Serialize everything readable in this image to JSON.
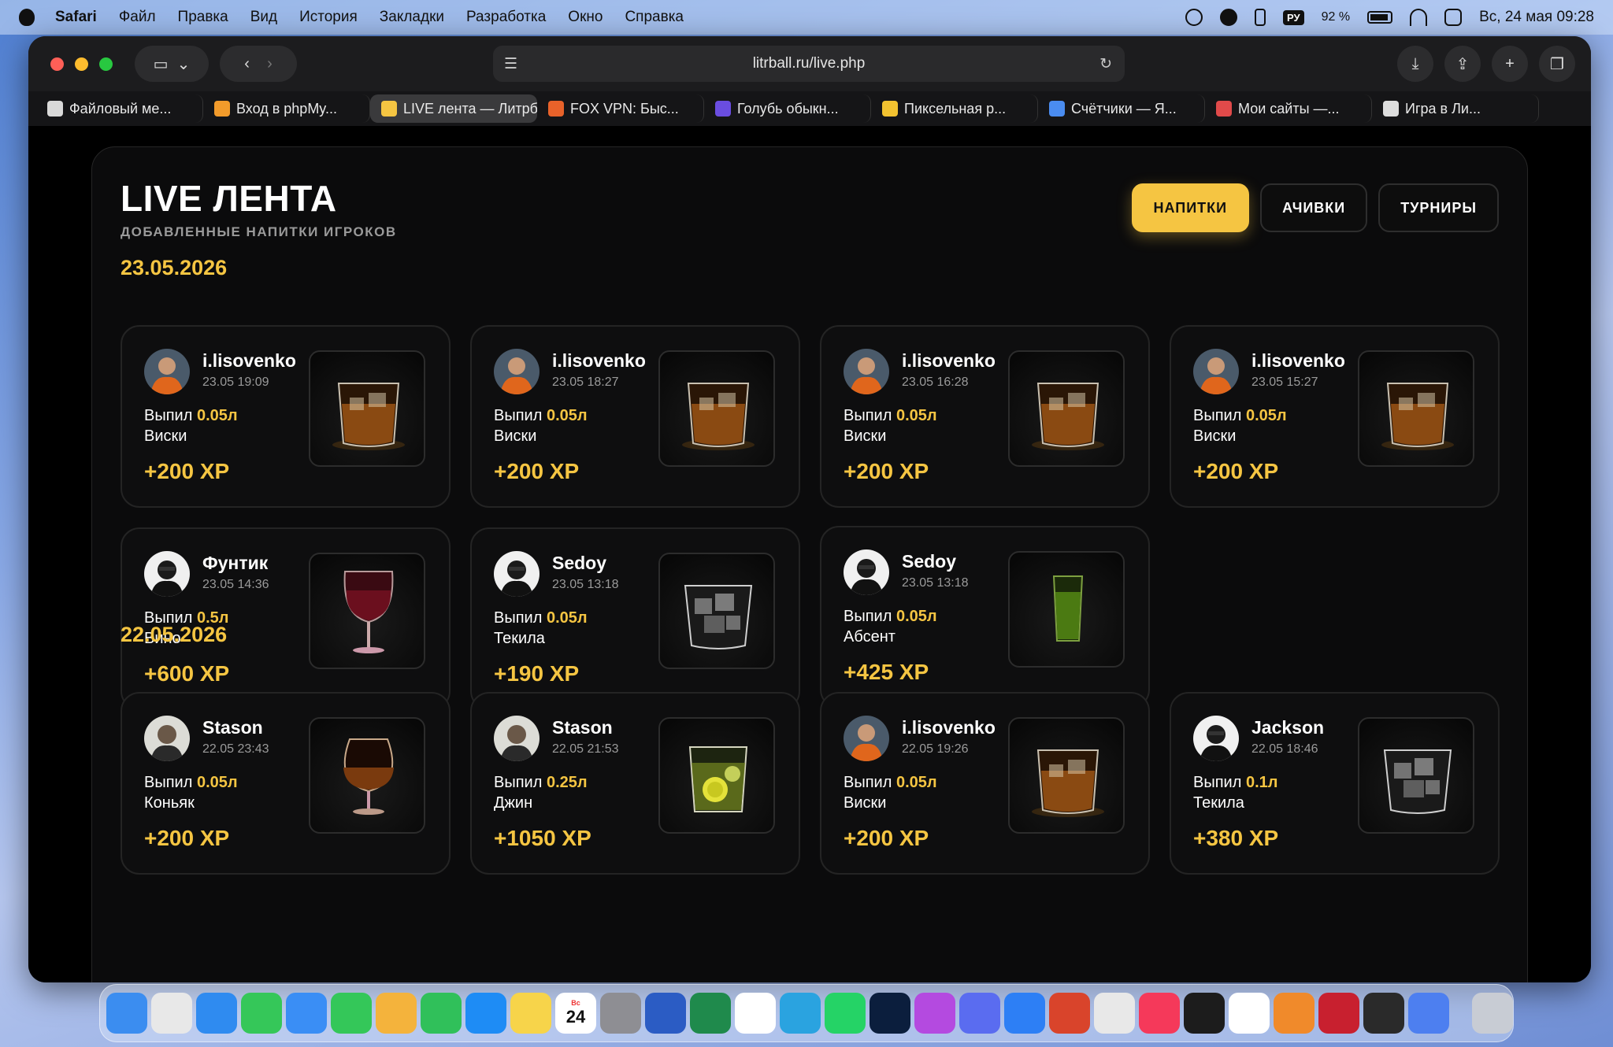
{
  "menubar": {
    "app": "Safari",
    "items": [
      "Файл",
      "Правка",
      "Вид",
      "История",
      "Закладки",
      "Разработка",
      "Окно",
      "Справка"
    ],
    "lang": "РУ",
    "battery": "92 %",
    "datetime": "Вс, 24 мая  09:28"
  },
  "browser": {
    "url": "litrball.ru/live.php",
    "tabs": [
      {
        "label": "Файловый ме...",
        "color": "#d9d9d9"
      },
      {
        "label": "Вход в phpMy...",
        "color": "#f29b2b"
      },
      {
        "label": "LIVE лента — Литрб...",
        "color": "#f5c542",
        "active": true
      },
      {
        "label": "FOX VPN: Быс...",
        "color": "#e8622a"
      },
      {
        "label": "Голубь обыкн...",
        "color": "#6a4de0"
      },
      {
        "label": "Пиксельная р...",
        "color": "#f2c230"
      },
      {
        "label": "Счётчики — Я...",
        "color": "#4a8cf0"
      },
      {
        "label": "Мои сайты —...",
        "color": "#e04a4a"
      },
      {
        "label": "Игра в Ли...",
        "color": "#dddddd"
      }
    ]
  },
  "page": {
    "title": "LIVE ЛЕНТА",
    "subtitle": "ДОБАВЛЕННЫЕ НАПИТКИ ИГРОКОВ",
    "buttons": [
      "НАПИТКИ",
      "АЧИВКИ",
      "ТУРНИРЫ"
    ],
    "drank_prefix": "Выпил",
    "groups": [
      {
        "date": "23.05.2026",
        "items": [
          {
            "user": "i.lisovenko",
            "time": "23.05 19:09",
            "amount": "0.05л",
            "drink": "Виски",
            "xp": "+200 XP",
            "avatar": "orange",
            "glass": "whisky"
          },
          {
            "user": "i.lisovenko",
            "time": "23.05 18:27",
            "amount": "0.05л",
            "drink": "Виски",
            "xp": "+200 XP",
            "avatar": "orange",
            "glass": "whisky"
          },
          {
            "user": "i.lisovenko",
            "time": "23.05 16:28",
            "amount": "0.05л",
            "drink": "Виски",
            "xp": "+200 XP",
            "avatar": "orange",
            "glass": "whisky"
          },
          {
            "user": "i.lisovenko",
            "time": "23.05 15:27",
            "amount": "0.05л",
            "drink": "Виски",
            "xp": "+200 XP",
            "avatar": "orange",
            "glass": "whisky"
          },
          {
            "user": "Фунтик",
            "time": "23.05 14:36",
            "amount": "0.5л",
            "drink": "Вино",
            "xp": "+600 XP",
            "avatar": "bw",
            "glass": "wine"
          },
          {
            "user": "Sedoy",
            "time": "23.05 13:18",
            "amount": "0.05л",
            "drink": "Текила",
            "xp": "+190 XP",
            "avatar": "bw",
            "glass": "ice"
          },
          {
            "user": "Sedoy",
            "time": "23.05 13:18",
            "amount": "0.05л",
            "drink": "Абсент",
            "xp": "+425 XP",
            "avatar": "bw",
            "glass": "shot"
          }
        ]
      },
      {
        "date": "22.05.2026",
        "items": [
          {
            "user": "Stason",
            "time": "22.05 23:43",
            "amount": "0.05л",
            "drink": "Коньяк",
            "xp": "+200 XP",
            "avatar": "photo",
            "glass": "cognac"
          },
          {
            "user": "Stason",
            "time": "22.05 21:53",
            "amount": "0.25л",
            "drink": "Джин",
            "xp": "+1050 XP",
            "avatar": "photo",
            "glass": "gin"
          },
          {
            "user": "i.lisovenko",
            "time": "22.05 19:26",
            "amount": "0.05л",
            "drink": "Виски",
            "xp": "+200 XP",
            "avatar": "orange",
            "glass": "whisky"
          },
          {
            "user": "Jackson",
            "time": "22.05 18:46",
            "amount": "0.1л",
            "drink": "Текила",
            "xp": "+380 XP",
            "avatar": "bw",
            "glass": "ice"
          }
        ]
      }
    ]
  },
  "dock": [
    {
      "name": "finder",
      "color": "#3b8df0"
    },
    {
      "name": "launchpad",
      "color": "#e8e8e8"
    },
    {
      "name": "safari",
      "color": "#2f8bf0"
    },
    {
      "name": "messages",
      "color": "#35c759"
    },
    {
      "name": "mail",
      "color": "#3a8ef5"
    },
    {
      "name": "find-my",
      "color": "#34c759"
    },
    {
      "name": "photos",
      "color": "#f4b33c"
    },
    {
      "name": "facetime",
      "color": "#30c05a"
    },
    {
      "name": "app-store",
      "color": "#1e8cf5"
    },
    {
      "name": "notes",
      "color": "#f7d44a"
    },
    {
      "name": "calendar",
      "color": "#ffffff"
    },
    {
      "name": "settings",
      "color": "#8e8e93"
    },
    {
      "name": "word",
      "color": "#2b5cc4"
    },
    {
      "name": "excel",
      "color": "#1f8a4c"
    },
    {
      "name": "table",
      "color": "#ffffff"
    },
    {
      "name": "telegram",
      "color": "#2aa3e0"
    },
    {
      "name": "whatsapp",
      "color": "#25d366"
    },
    {
      "name": "photoshop",
      "color": "#0b1e3d"
    },
    {
      "name": "app-purple",
      "color": "#b44ae0"
    },
    {
      "name": "simulator",
      "color": "#5a6cf0"
    },
    {
      "name": "xcode",
      "color": "#2d7ff5"
    },
    {
      "name": "app-red",
      "color": "#d9442b"
    },
    {
      "name": "chrome",
      "color": "#e8e8e8"
    },
    {
      "name": "music",
      "color": "#f5395a"
    },
    {
      "name": "terminal",
      "color": "#1c1c1c"
    },
    {
      "name": "chatgpt",
      "color": "#ffffff"
    },
    {
      "name": "fox",
      "color": "#f08a2b"
    },
    {
      "name": "app-red2",
      "color": "#c8202f"
    },
    {
      "name": "app-dark",
      "color": "#2a2a2a"
    },
    {
      "name": "app-color",
      "color": "#4d7ff0"
    },
    {
      "name": "trash",
      "color": "#c8ccd4"
    }
  ],
  "calendar_day": "24",
  "calendar_label": "Вс"
}
